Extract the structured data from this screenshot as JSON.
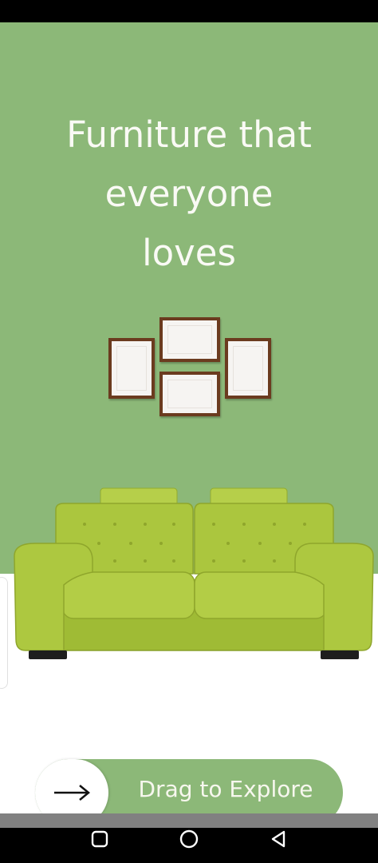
{
  "hero": {
    "headline_lines": [
      "Furniture that",
      "everyone",
      "loves"
    ]
  },
  "cta": {
    "label": "Drag to Explore",
    "arrow_icon": "arrow-right-icon"
  },
  "colors": {
    "hero_background": "#8cb878",
    "sofa": "#a9c43c",
    "frame": "#6b3b1f"
  },
  "icons": {
    "recents": "square-icon",
    "home": "circle-icon",
    "back": "triangle-back-icon"
  }
}
